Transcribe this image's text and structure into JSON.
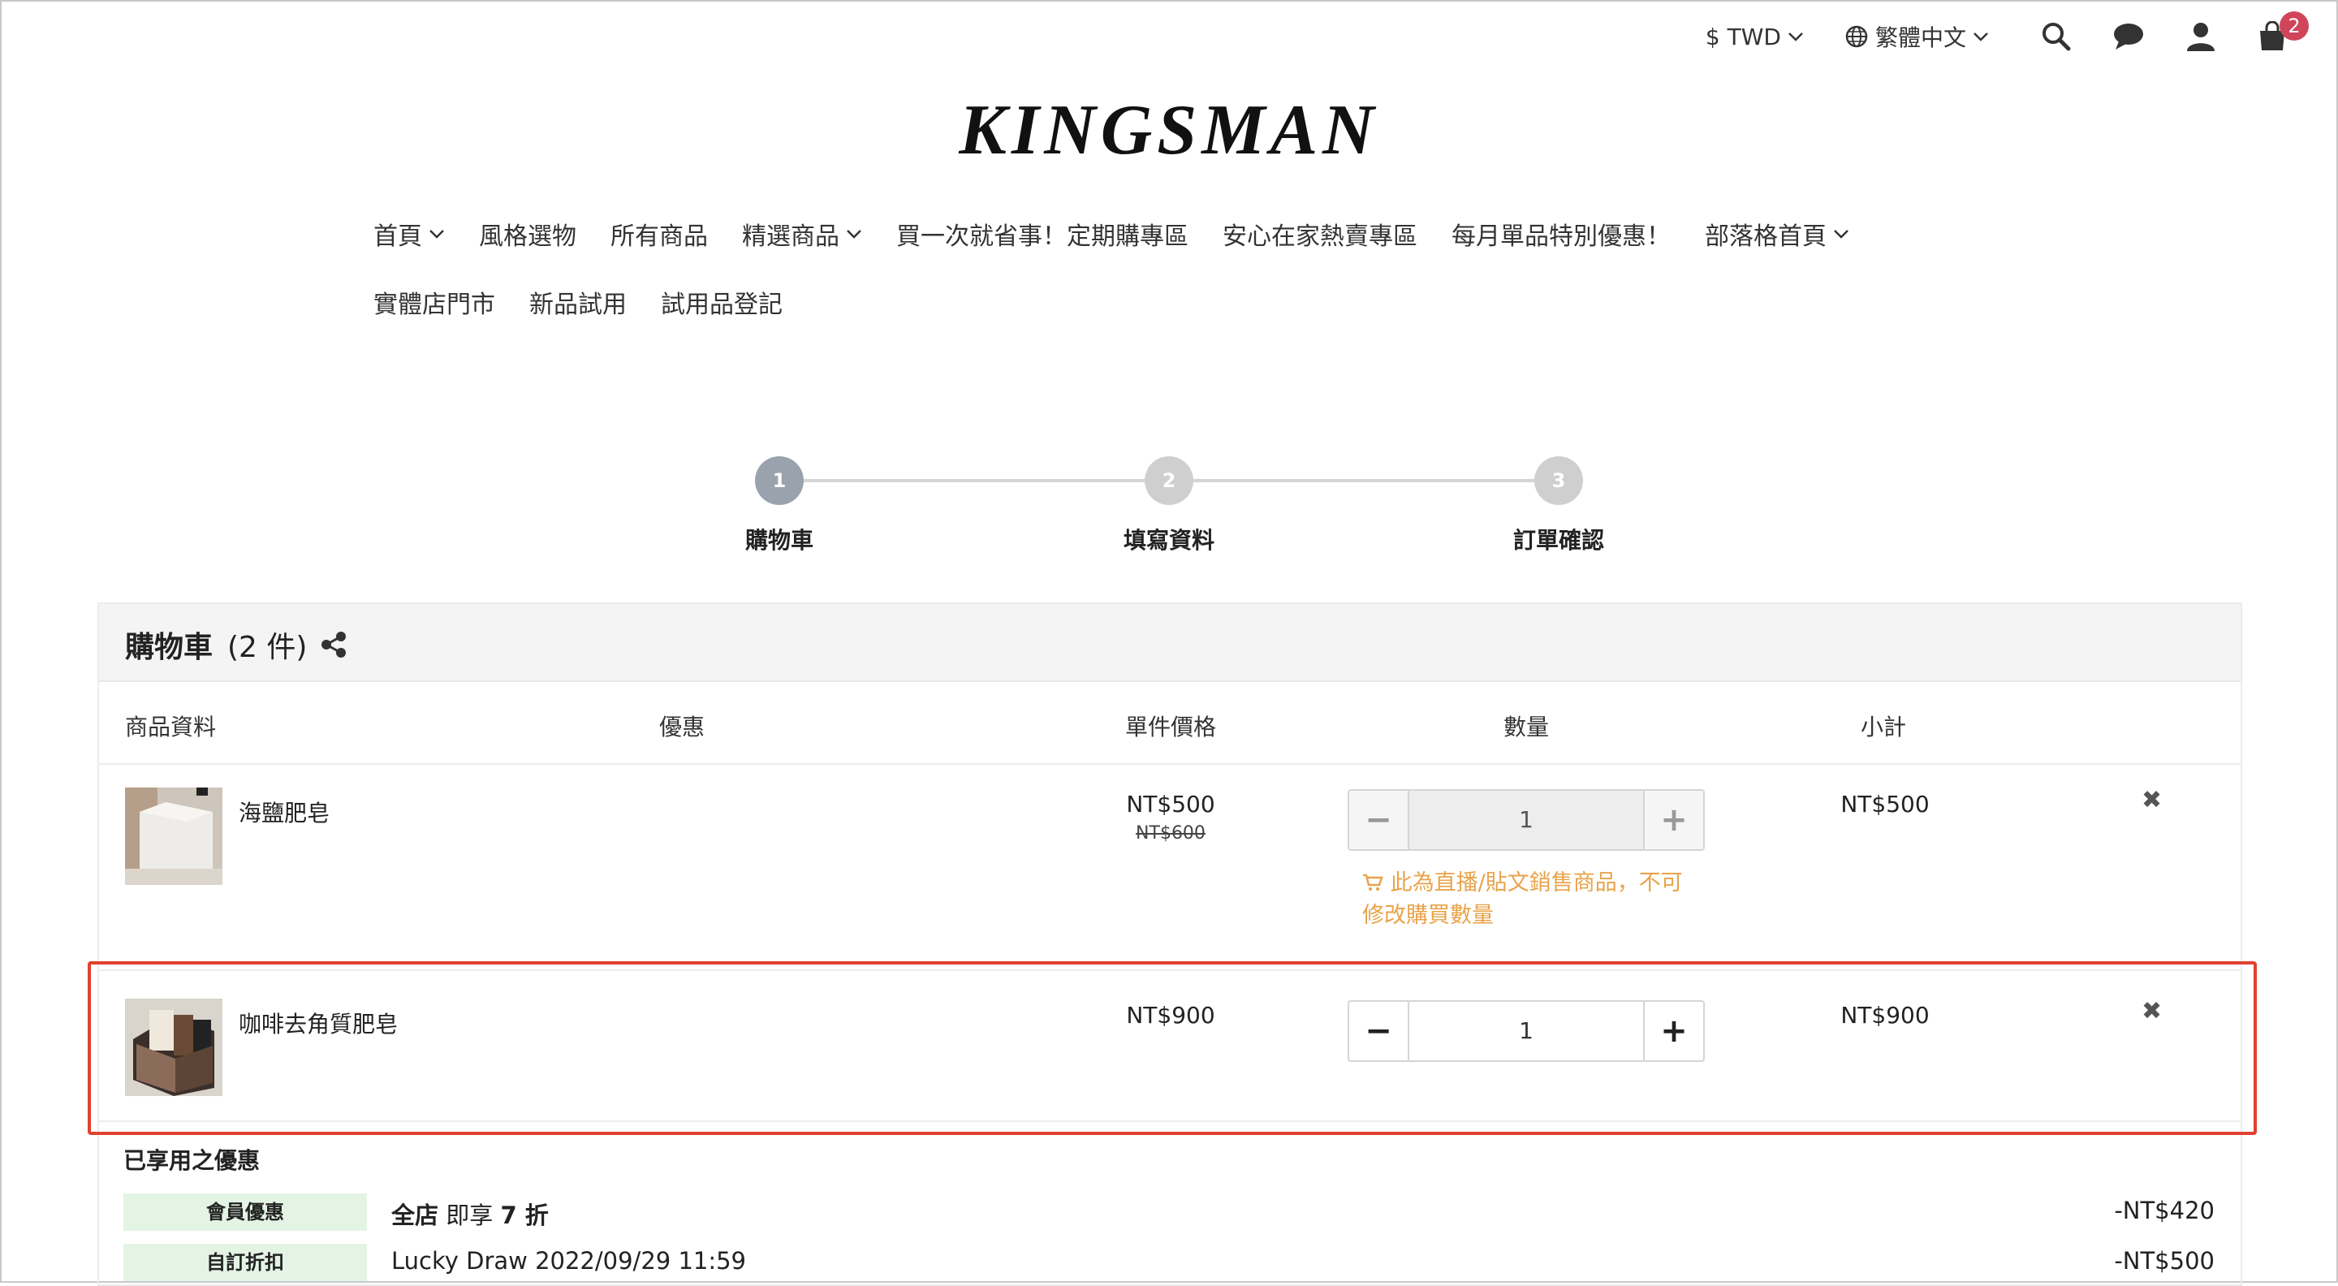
{
  "topbar": {
    "currency": "$ TWD",
    "language": "繁體中文",
    "cart_count": "2"
  },
  "logo": "KINGSMAN",
  "nav": {
    "row1": [
      "首頁",
      "風格選物",
      "所有商品",
      "精選商品",
      "買一次就省事！定期購專區",
      "安心在家熱賣專區",
      "每月單品特別優惠！",
      "部落格首頁"
    ],
    "row1_dropdown": [
      true,
      false,
      false,
      true,
      false,
      false,
      false,
      true
    ],
    "row2": [
      "實體店門市",
      "新品試用",
      "試用品登記"
    ]
  },
  "stepper": {
    "steps": [
      {
        "num": "1",
        "label": "購物車",
        "active": true
      },
      {
        "num": "2",
        "label": "填寫資料",
        "active": false
      },
      {
        "num": "3",
        "label": "訂單確認",
        "active": false
      }
    ]
  },
  "cart": {
    "title": "購物車",
    "count_label": "(2 件)",
    "columns": {
      "product": "商品資料",
      "discount": "優惠",
      "unit_price": "單件價格",
      "quantity": "數量",
      "subtotal": "小計"
    },
    "items": [
      {
        "name": "海鹽肥皂",
        "price": "NT$500",
        "old_price": "NT$600",
        "quantity": "1",
        "subtotal": "NT$500",
        "locked": true,
        "warning": "此為直播/貼文銷售商品，不可修改購買數量"
      },
      {
        "name": "咖啡去角質肥皂",
        "price": "NT$900",
        "old_price": "",
        "quantity": "1",
        "subtotal": "NT$900",
        "locked": false,
        "warning": ""
      }
    ]
  },
  "discounts": {
    "title": "已享用之優惠",
    "rows": [
      {
        "tag": "會員優惠",
        "bold": "全店",
        "text": " 即享 ",
        "bold2": "7 折",
        "amount": "-NT$420"
      },
      {
        "tag": "自訂折扣",
        "bold": "",
        "text": "Lucky Draw 2022/09/29 11:59",
        "bold2": "",
        "amount": "-NT$500"
      }
    ]
  },
  "colors": {
    "accent_red": "#e0412f",
    "warning_orange": "#e8a34a",
    "badge": "#d0455a",
    "step_active": "#9aa3ad",
    "step_inactive": "#cfcfcf",
    "discount_tag_bg": "#e4f4e4"
  },
  "icons": {
    "search": "search-icon",
    "chat": "chat-icon",
    "user": "user-icon",
    "cart": "shopping-bag-icon",
    "globe": "globe-icon",
    "share": "share-icon",
    "remove": "close-icon",
    "warning_cart": "cart-warning-icon"
  }
}
